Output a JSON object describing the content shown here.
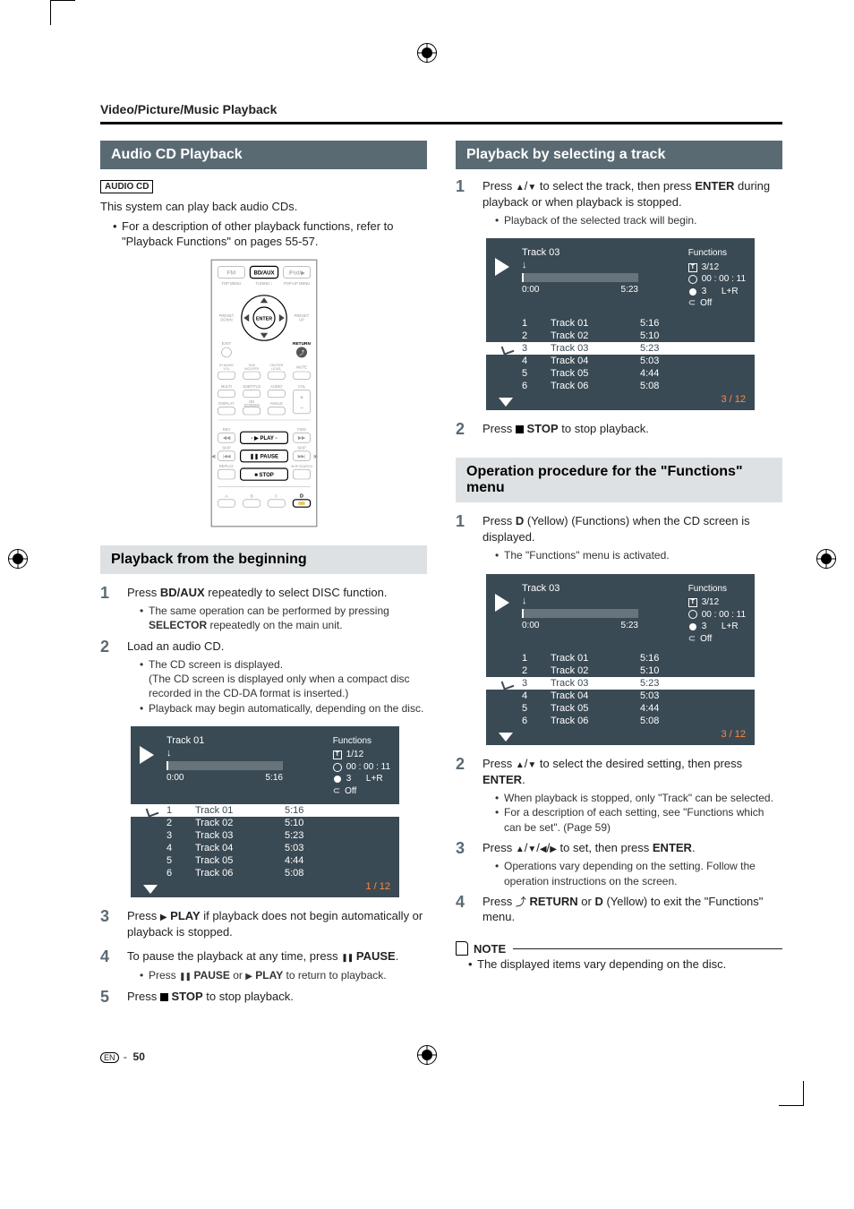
{
  "breadcrumb": "Video/Picture/Music Playback",
  "left": {
    "heading1": "Audio CD Playback",
    "badge": "AUDIO CD",
    "intro": "This system can play back audio CDs.",
    "bullet1": "For a description of other playback functions, refer to \"Playback Functions\" on pages 55-57.",
    "sub_heading": "Playback from the beginning",
    "step1_a": "Press ",
    "step1_key": "BD/AUX",
    "step1_b": " repeatedly to select DISC function.",
    "step1_sub_a": "The same operation can be performed by pressing ",
    "step1_sub_key": "SELECTOR",
    "step1_sub_b": " repeatedly on the main unit.",
    "step2": "Load an audio CD.",
    "step2_sub1": "The CD screen is displayed.",
    "step2_sub1_note": "(The CD screen is displayed only when a compact disc recorded in the CD-DA format is inserted.)",
    "step2_sub2": "Playback may begin automatically, depending on the disc.",
    "step3_a": "Press ",
    "step3_key": "PLAY",
    "step3_b": " if playback does not begin automatically or playback is stopped.",
    "step4_a": "To pause the playback at any time, press ",
    "step4_key": "PAUSE",
    "step4_b": ".",
    "step4_sub_a": "Press ",
    "step4_sub_key1": "PAUSE",
    "step4_sub_mid": " or ",
    "step4_sub_key2": "PLAY",
    "step4_sub_b": " to return to playback.",
    "step5_a": "Press ",
    "step5_key": "STOP",
    "step5_b": " to stop playback."
  },
  "right": {
    "heading1": "Playback by selecting a track",
    "s1_a": "Press ",
    "s1_b": " to select the track, then press ",
    "s1_key": "ENTER",
    "s1_c": " during playback or when playback is stopped.",
    "s1_sub": "Playback of the selected track will begin.",
    "s2_a": "Press ",
    "s2_key": "STOP",
    "s2_b": " to stop playback.",
    "heading2": "Operation procedure for the \"Functions\" menu",
    "op1_a": "Press ",
    "op1_key": "D",
    "op1_b": " (Yellow) (Functions) when the CD screen is displayed.",
    "op1_sub": "The \"Functions\" menu is activated.",
    "op2_a": "Press ",
    "op2_b": " to select the desired setting, then press ",
    "op2_key": "ENTER",
    "op2_c": ".",
    "op2_sub1": "When playback is stopped, only \"Track\" can be selected.",
    "op2_sub2": "For a description of each setting, see \"Functions which can be set\". (Page 59)",
    "op3_a": "Press ",
    "op3_b": " to set, then press ",
    "op3_key": "ENTER",
    "op3_c": ".",
    "op3_sub": "Operations vary depending on the setting. Follow the operation instructions on the screen.",
    "op4_a": "Press ",
    "op4_key1": "RETURN",
    "op4_mid": " or ",
    "op4_key2": "D",
    "op4_b": " (Yellow) to exit the \"Functions\" menu.",
    "note_label": "NOTE",
    "note1": "The displayed items vary depending on the disc."
  },
  "screen_a": {
    "title": "Track 01",
    "time_left": "0:00",
    "time_right": "5:16",
    "functions_label": "Functions",
    "func_track": "1/12",
    "func_time": "00 : 00 : 11",
    "func_rep": "3      L+R",
    "func_off": "Off",
    "selected_index": 0,
    "tracks": [
      {
        "n": "1",
        "name": "Track 01",
        "t": "5:16"
      },
      {
        "n": "2",
        "name": "Track 02",
        "t": "5:10"
      },
      {
        "n": "3",
        "name": "Track 03",
        "t": "5:23"
      },
      {
        "n": "4",
        "name": "Track 04",
        "t": "5:03"
      },
      {
        "n": "5",
        "name": "Track 05",
        "t": "4:44"
      },
      {
        "n": "6",
        "name": "Track 06",
        "t": "5:08"
      }
    ],
    "page": "1 / 12"
  },
  "screen_b": {
    "title": "Track 03",
    "time_left": "0:00",
    "time_right": "5:23",
    "functions_label": "Functions",
    "func_track": "3/12",
    "func_time": "00 : 00 : 11",
    "func_rep": "3      L+R",
    "func_off": "Off",
    "selected_index": 2,
    "tracks": [
      {
        "n": "1",
        "name": "Track 01",
        "t": "5:16"
      },
      {
        "n": "2",
        "name": "Track 02",
        "t": "5:10"
      },
      {
        "n": "3",
        "name": "Track 03",
        "t": "5:23"
      },
      {
        "n": "4",
        "name": "Track 04",
        "t": "5:03"
      },
      {
        "n": "5",
        "name": "Track 05",
        "t": "4:44"
      },
      {
        "n": "6",
        "name": "Track 06",
        "t": "5:08"
      }
    ],
    "page": "3 / 12"
  },
  "screen_c": {
    "title": "Track 03",
    "time_left": "0:00",
    "time_right": "5:23",
    "functions_label": "Functions",
    "func_track": "3/12",
    "func_time": "00 : 00 : 11",
    "func_rep": "3      L+R",
    "func_off": "Off",
    "selected_index": 2,
    "tracks": [
      {
        "n": "1",
        "name": "Track 01",
        "t": "5:16"
      },
      {
        "n": "2",
        "name": "Track 02",
        "t": "5:10"
      },
      {
        "n": "3",
        "name": "Track 03",
        "t": "5:23"
      },
      {
        "n": "4",
        "name": "Track 04",
        "t": "5:03"
      },
      {
        "n": "5",
        "name": "Track 05",
        "t": "4:44"
      },
      {
        "n": "6",
        "name": "Track 06",
        "t": "5:08"
      }
    ],
    "page": "3 / 12"
  },
  "remote_labels": {
    "fm": "FM",
    "bdaux": "BD/AUX",
    "ipod": "iPod/▶",
    "topmenu": "TOP MENU",
    "tuning": "TUNING",
    "popup": "POP-UP MENU",
    "presetdown": "PRESET\\nDOWN",
    "presetup": "PRESET\\nUP",
    "enter": "ENTER",
    "exit": "EXIT",
    "return": "RETURN",
    "dynamic": "DYNAMIC\\nVOL",
    "sub": "SUB\\nWOOFER",
    "center": "CENTER\\nLEVEL",
    "mute": "MUTE",
    "multi": "MULTI",
    "subtitle": "SUBTITLE",
    "audio": "AUDIO",
    "vol": "VOL",
    "display": "DISPLAY",
    "onscreen": "ON\\nSCREEN",
    "angle": "ANGLE",
    "rev": "REV",
    "fwd": "FWD",
    "play": "▶ PLAY",
    "skipl": "SKIP",
    "skipr": "SKIP",
    "pause": "❚❚ PAUSE",
    "replay": "REPLAY",
    "stop": "■ STOP",
    "skipsearch": "SKIP SEARCH",
    "a": "A",
    "b": "B",
    "c": "C",
    "d": "D"
  },
  "page_num_prefix": "EN",
  "page_num": "50"
}
